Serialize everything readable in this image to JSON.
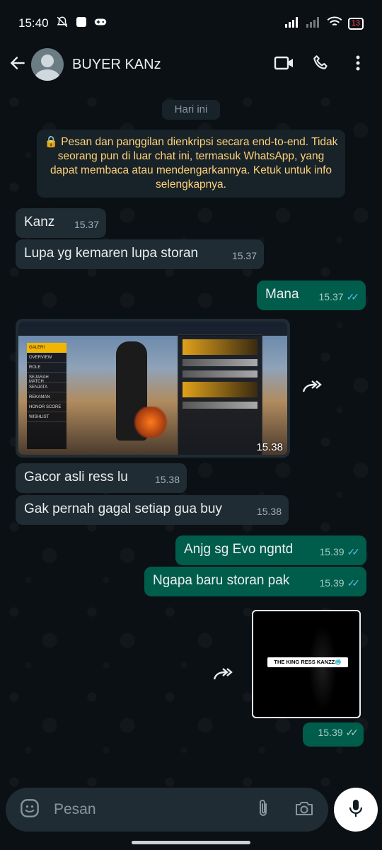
{
  "status_bar": {
    "time": "15:40",
    "battery": "13"
  },
  "header": {
    "contact_name": "BUYER KANz"
  },
  "chat": {
    "date_chip": "Hari ini",
    "encryption_notice": "🔒 Pesan dan panggilan dienkripsi secara end-to-end. Tidak seorang pun di luar chat ini, termasuk WhatsApp, yang dapat membaca atau mendengarkannya. Ketuk untuk info selengkapnya.",
    "messages": [
      {
        "dir": "in",
        "text": "Kanz",
        "time": "15.37"
      },
      {
        "dir": "in",
        "text": "Lupa yg kemaren lupa storan",
        "time": "15.37"
      },
      {
        "dir": "out",
        "text": "Mana",
        "time": "15.37"
      },
      {
        "dir": "in",
        "type": "image",
        "time": "15.38"
      },
      {
        "dir": "in",
        "text": "Gacor asli ress lu",
        "time": "15.38"
      },
      {
        "dir": "in",
        "text": "Gak pernah gagal setiap gua buy",
        "time": "15.38"
      },
      {
        "dir": "out",
        "text": "Anjg sg Evo ngntd",
        "time": "15.39"
      },
      {
        "dir": "out",
        "text": "Ngapa baru storan pak",
        "time": "15.39"
      },
      {
        "dir": "out",
        "type": "image",
        "image_label": "THE KING RESS KANZZ🥶",
        "time": "15.39"
      }
    ]
  },
  "game_screenshot": {
    "menu": [
      "GALERI",
      "OVERVIEW",
      "ROLE",
      "SEJARAH MATCH",
      "SENJATA",
      "REKAMAN",
      "HONOR SCORE",
      "WISHLIST"
    ]
  },
  "input": {
    "placeholder": "Pesan"
  },
  "icons": [
    "back-arrow-icon",
    "video-call-icon",
    "voice-call-icon",
    "more-vert-icon",
    "forward-icon",
    "emoji-icon",
    "attach-icon",
    "camera-icon",
    "mic-icon"
  ],
  "colors": {
    "background": "#0b1014",
    "incoming_bubble": "#202c33",
    "outgoing_bubble": "#005c4b",
    "notice_text": "#ffd279",
    "read_ticks": "#53bdeb"
  }
}
